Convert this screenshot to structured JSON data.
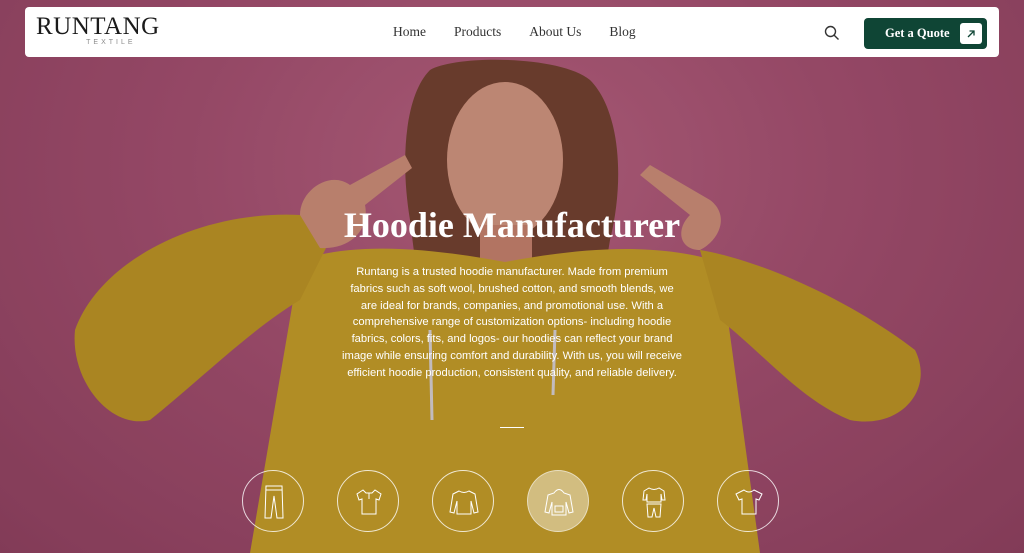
{
  "brand": {
    "name": "RUNTANG",
    "tagline": "TEXTILE"
  },
  "nav": {
    "links": [
      "Home",
      "Products",
      "About Us",
      "Blog"
    ],
    "quote_label": "Get a Quote"
  },
  "hero": {
    "title": "Hoodie Manufacturer",
    "description": "Runtang is a trusted hoodie manufacturer. Made from premium fabrics such as soft wool, brushed cotton, and smooth blends, we are ideal for brands, companies, and promotional use. With a comprehensive range of customization options- including hoodie fabrics, colors, fits, and logos- our hoodies can reflect your brand image while ensuring comfort and durability. With us, you will receive efficient hoodie production, consistent quality, and reliable delivery."
  },
  "categories": [
    {
      "icon": "leggings-icon",
      "active": false
    },
    {
      "icon": "polo-shirt-icon",
      "active": false
    },
    {
      "icon": "sweatshirt-icon",
      "active": false
    },
    {
      "icon": "hoodie-icon",
      "active": true
    },
    {
      "icon": "tracksuit-icon",
      "active": false
    },
    {
      "icon": "t-shirt-icon",
      "active": false
    }
  ],
  "colors": {
    "accent": "#0f4535",
    "background": "#b45d7e",
    "sweater": "#d8b32a"
  }
}
